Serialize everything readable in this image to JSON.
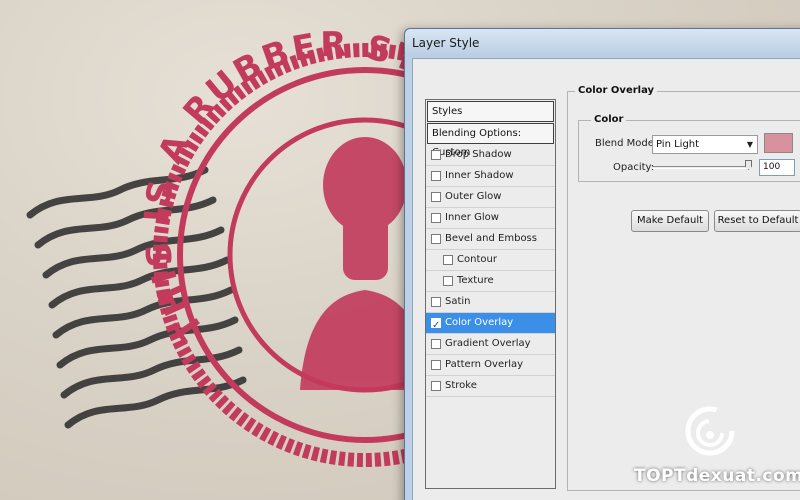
{
  "background": {
    "stamp_text": "THIS IS A RUBBER STAMP",
    "stamp_color": "#c23a5c",
    "wave_color": "#2a2a2a"
  },
  "dialog": {
    "title": "Layer Style"
  },
  "styles_list": {
    "header": "Styles",
    "blending_options": "Blending Options: Custom",
    "items": [
      {
        "label": "Drop Shadow",
        "checked": false,
        "sub": false
      },
      {
        "label": "Inner Shadow",
        "checked": false,
        "sub": false
      },
      {
        "label": "Outer Glow",
        "checked": false,
        "sub": false
      },
      {
        "label": "Inner Glow",
        "checked": false,
        "sub": false
      },
      {
        "label": "Bevel and Emboss",
        "checked": false,
        "sub": false
      },
      {
        "label": "Contour",
        "checked": false,
        "sub": true
      },
      {
        "label": "Texture",
        "checked": false,
        "sub": true
      },
      {
        "label": "Satin",
        "checked": false,
        "sub": false
      },
      {
        "label": "Color Overlay",
        "checked": true,
        "sub": false,
        "selected": true
      },
      {
        "label": "Gradient Overlay",
        "checked": false,
        "sub": false
      },
      {
        "label": "Pattern Overlay",
        "checked": false,
        "sub": false
      },
      {
        "label": "Stroke",
        "checked": false,
        "sub": false
      }
    ]
  },
  "settings": {
    "section_title": "Color Overlay",
    "group_title": "Color",
    "blend_mode_label": "Blend Mode:",
    "blend_mode_value": "Pin Light",
    "overlay_color": "#d8929e",
    "opacity_label": "Opacity:",
    "opacity_value": "100",
    "opacity_unit": "%",
    "make_default": "Make Default",
    "reset_default": "Reset to Default"
  },
  "watermark": {
    "text": "TOPTdexuat.com"
  }
}
